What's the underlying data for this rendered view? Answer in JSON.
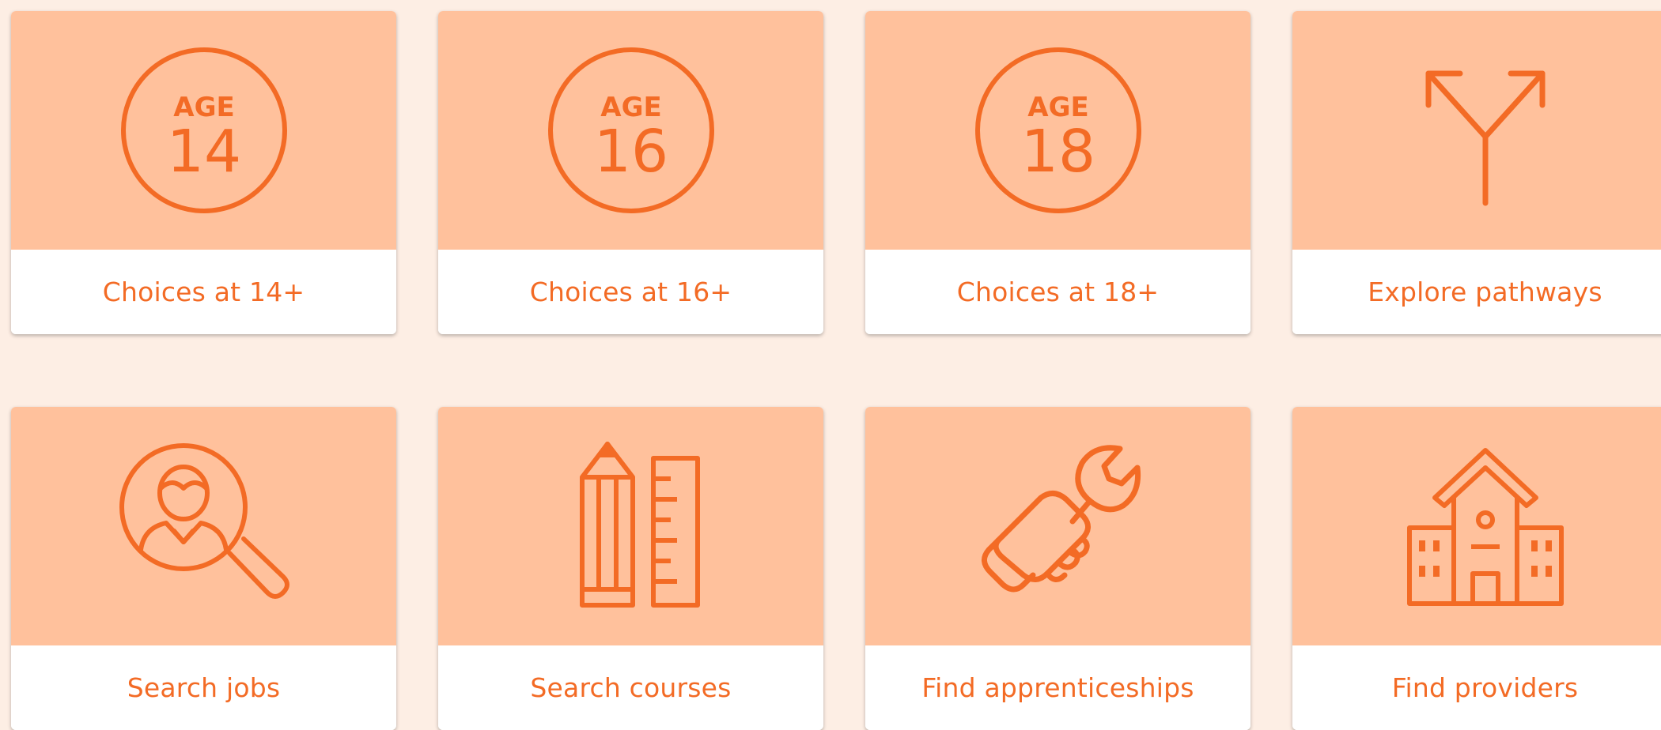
{
  "colors": {
    "page_background": "#fdeee4",
    "tile_background": "#ffc19c",
    "accent": "#f36b25",
    "label_background": "#ffffff"
  },
  "tiles": [
    {
      "label": "Choices at 14+",
      "icon": "age-14-icon",
      "badge_top": "AGE",
      "badge_number": "14"
    },
    {
      "label": "Choices at 16+",
      "icon": "age-16-icon",
      "badge_top": "AGE",
      "badge_number": "16"
    },
    {
      "label": "Choices at 18+",
      "icon": "age-18-icon",
      "badge_top": "AGE",
      "badge_number": "18"
    },
    {
      "label": "Explore pathways",
      "icon": "branching-arrows-icon"
    },
    {
      "label": "Search jobs",
      "icon": "person-search-icon"
    },
    {
      "label": "Search courses",
      "icon": "pencil-ruler-icon"
    },
    {
      "label": "Find apprenticeships",
      "icon": "hand-wrench-icon"
    },
    {
      "label": "Find providers",
      "icon": "school-building-icon"
    }
  ]
}
